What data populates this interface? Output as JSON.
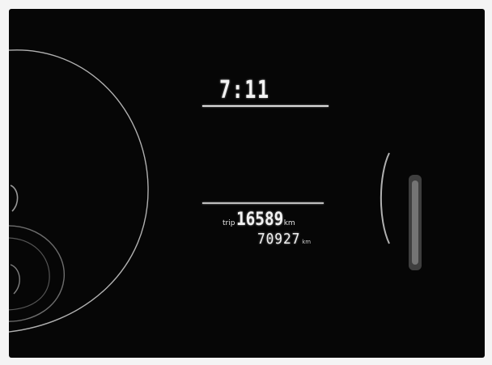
{
  "display": {
    "clock": "7:11",
    "trip_label": "trip",
    "trip_value": "16589",
    "trip_unit": "km",
    "odometer_value": "70927",
    "odometer_unit": "km"
  },
  "colors": {
    "panel_background": "#060606",
    "photo_border": "#f4f4f4",
    "segment_text": "#f2f2f2",
    "gauge_ring": "#cfcfcf"
  }
}
